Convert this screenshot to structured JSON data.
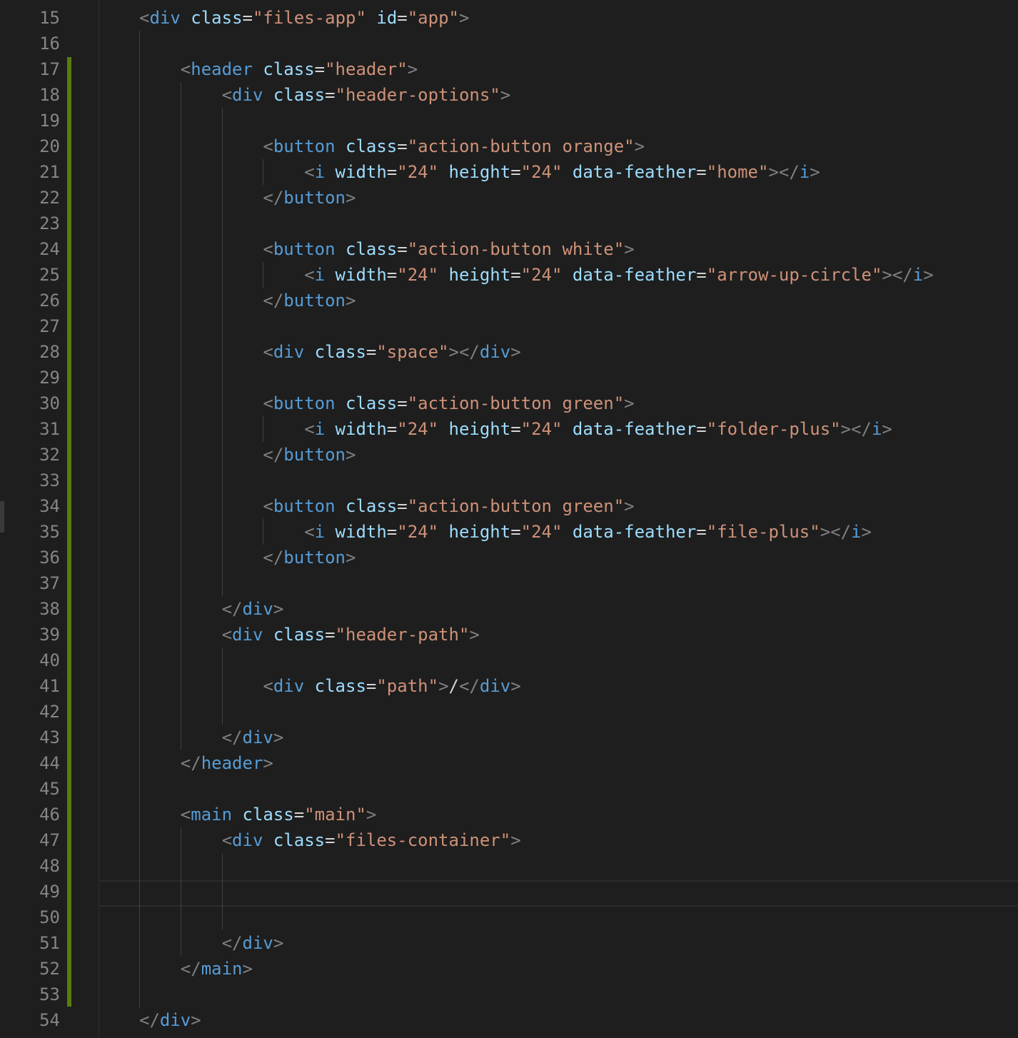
{
  "editor": {
    "lines": [
      {
        "number": "15",
        "indent": 1,
        "tokens": [
          {
            "t": "punct",
            "v": "<"
          },
          {
            "t": "tag",
            "v": "div"
          },
          {
            "t": "text",
            "v": " "
          },
          {
            "t": "attr",
            "v": "class"
          },
          {
            "t": "eq",
            "v": "="
          },
          {
            "t": "str",
            "v": "\"files-app\""
          },
          {
            "t": "text",
            "v": " "
          },
          {
            "t": "attr",
            "v": "id"
          },
          {
            "t": "eq",
            "v": "="
          },
          {
            "t": "str",
            "v": "\"app\""
          },
          {
            "t": "punct",
            "v": ">"
          }
        ]
      },
      {
        "number": "16",
        "indent": 0,
        "tokens": []
      },
      {
        "number": "17",
        "indent": 2,
        "tokens": [
          {
            "t": "punct",
            "v": "<"
          },
          {
            "t": "tag",
            "v": "header"
          },
          {
            "t": "text",
            "v": " "
          },
          {
            "t": "attr",
            "v": "class"
          },
          {
            "t": "eq",
            "v": "="
          },
          {
            "t": "str",
            "v": "\"header\""
          },
          {
            "t": "punct",
            "v": ">"
          }
        ]
      },
      {
        "number": "18",
        "indent": 3,
        "tokens": [
          {
            "t": "punct",
            "v": "<"
          },
          {
            "t": "tag",
            "v": "div"
          },
          {
            "t": "text",
            "v": " "
          },
          {
            "t": "attr",
            "v": "class"
          },
          {
            "t": "eq",
            "v": "="
          },
          {
            "t": "str",
            "v": "\"header-options\""
          },
          {
            "t": "punct",
            "v": ">"
          }
        ]
      },
      {
        "number": "19",
        "indent": 0,
        "tokens": []
      },
      {
        "number": "20",
        "indent": 4,
        "tokens": [
          {
            "t": "punct",
            "v": "<"
          },
          {
            "t": "tag",
            "v": "button"
          },
          {
            "t": "text",
            "v": " "
          },
          {
            "t": "attr",
            "v": "class"
          },
          {
            "t": "eq",
            "v": "="
          },
          {
            "t": "str",
            "v": "\"action-button orange\""
          },
          {
            "t": "punct",
            "v": ">"
          }
        ]
      },
      {
        "number": "21",
        "indent": 5,
        "tokens": [
          {
            "t": "punct",
            "v": "<"
          },
          {
            "t": "tag",
            "v": "i"
          },
          {
            "t": "text",
            "v": " "
          },
          {
            "t": "attr",
            "v": "width"
          },
          {
            "t": "eq",
            "v": "="
          },
          {
            "t": "str",
            "v": "\"24\""
          },
          {
            "t": "text",
            "v": " "
          },
          {
            "t": "attr",
            "v": "height"
          },
          {
            "t": "eq",
            "v": "="
          },
          {
            "t": "str",
            "v": "\"24\""
          },
          {
            "t": "text",
            "v": " "
          },
          {
            "t": "attr",
            "v": "data-feather"
          },
          {
            "t": "eq",
            "v": "="
          },
          {
            "t": "str",
            "v": "\"home\""
          },
          {
            "t": "punct",
            "v": "></"
          },
          {
            "t": "tag",
            "v": "i"
          },
          {
            "t": "punct",
            "v": ">"
          }
        ]
      },
      {
        "number": "22",
        "indent": 4,
        "tokens": [
          {
            "t": "punct",
            "v": "</"
          },
          {
            "t": "tag",
            "v": "button"
          },
          {
            "t": "punct",
            "v": ">"
          }
        ]
      },
      {
        "number": "23",
        "indent": 0,
        "tokens": []
      },
      {
        "number": "24",
        "indent": 4,
        "tokens": [
          {
            "t": "punct",
            "v": "<"
          },
          {
            "t": "tag",
            "v": "button"
          },
          {
            "t": "text",
            "v": " "
          },
          {
            "t": "attr",
            "v": "class"
          },
          {
            "t": "eq",
            "v": "="
          },
          {
            "t": "str",
            "v": "\"action-button white\""
          },
          {
            "t": "punct",
            "v": ">"
          }
        ]
      },
      {
        "number": "25",
        "indent": 5,
        "tokens": [
          {
            "t": "punct",
            "v": "<"
          },
          {
            "t": "tag",
            "v": "i"
          },
          {
            "t": "text",
            "v": " "
          },
          {
            "t": "attr",
            "v": "width"
          },
          {
            "t": "eq",
            "v": "="
          },
          {
            "t": "str",
            "v": "\"24\""
          },
          {
            "t": "text",
            "v": " "
          },
          {
            "t": "attr",
            "v": "height"
          },
          {
            "t": "eq",
            "v": "="
          },
          {
            "t": "str",
            "v": "\"24\""
          },
          {
            "t": "text",
            "v": " "
          },
          {
            "t": "attr",
            "v": "data-feather"
          },
          {
            "t": "eq",
            "v": "="
          },
          {
            "t": "str",
            "v": "\"arrow-up-circle\""
          },
          {
            "t": "punct",
            "v": "></"
          },
          {
            "t": "tag",
            "v": "i"
          },
          {
            "t": "punct",
            "v": ">"
          }
        ]
      },
      {
        "number": "26",
        "indent": 4,
        "tokens": [
          {
            "t": "punct",
            "v": "</"
          },
          {
            "t": "tag",
            "v": "button"
          },
          {
            "t": "punct",
            "v": ">"
          }
        ]
      },
      {
        "number": "27",
        "indent": 0,
        "tokens": []
      },
      {
        "number": "28",
        "indent": 4,
        "tokens": [
          {
            "t": "punct",
            "v": "<"
          },
          {
            "t": "tag",
            "v": "div"
          },
          {
            "t": "text",
            "v": " "
          },
          {
            "t": "attr",
            "v": "class"
          },
          {
            "t": "eq",
            "v": "="
          },
          {
            "t": "str",
            "v": "\"space\""
          },
          {
            "t": "punct",
            "v": "></"
          },
          {
            "t": "tag",
            "v": "div"
          },
          {
            "t": "punct",
            "v": ">"
          }
        ]
      },
      {
        "number": "29",
        "indent": 0,
        "tokens": []
      },
      {
        "number": "30",
        "indent": 4,
        "tokens": [
          {
            "t": "punct",
            "v": "<"
          },
          {
            "t": "tag",
            "v": "button"
          },
          {
            "t": "text",
            "v": " "
          },
          {
            "t": "attr",
            "v": "class"
          },
          {
            "t": "eq",
            "v": "="
          },
          {
            "t": "str",
            "v": "\"action-button green\""
          },
          {
            "t": "punct",
            "v": ">"
          }
        ]
      },
      {
        "number": "31",
        "indent": 5,
        "tokens": [
          {
            "t": "punct",
            "v": "<"
          },
          {
            "t": "tag",
            "v": "i"
          },
          {
            "t": "text",
            "v": " "
          },
          {
            "t": "attr",
            "v": "width"
          },
          {
            "t": "eq",
            "v": "="
          },
          {
            "t": "str",
            "v": "\"24\""
          },
          {
            "t": "text",
            "v": " "
          },
          {
            "t": "attr",
            "v": "height"
          },
          {
            "t": "eq",
            "v": "="
          },
          {
            "t": "str",
            "v": "\"24\""
          },
          {
            "t": "text",
            "v": " "
          },
          {
            "t": "attr",
            "v": "data-feather"
          },
          {
            "t": "eq",
            "v": "="
          },
          {
            "t": "str",
            "v": "\"folder-plus\""
          },
          {
            "t": "punct",
            "v": "></"
          },
          {
            "t": "tag",
            "v": "i"
          },
          {
            "t": "punct",
            "v": ">"
          }
        ]
      },
      {
        "number": "32",
        "indent": 4,
        "tokens": [
          {
            "t": "punct",
            "v": "</"
          },
          {
            "t": "tag",
            "v": "button"
          },
          {
            "t": "punct",
            "v": ">"
          }
        ]
      },
      {
        "number": "33",
        "indent": 0,
        "tokens": []
      },
      {
        "number": "34",
        "indent": 4,
        "tokens": [
          {
            "t": "punct",
            "v": "<"
          },
          {
            "t": "tag",
            "v": "button"
          },
          {
            "t": "text",
            "v": " "
          },
          {
            "t": "attr",
            "v": "class"
          },
          {
            "t": "eq",
            "v": "="
          },
          {
            "t": "str",
            "v": "\"action-button green\""
          },
          {
            "t": "punct",
            "v": ">"
          }
        ]
      },
      {
        "number": "35",
        "indent": 5,
        "tokens": [
          {
            "t": "punct",
            "v": "<"
          },
          {
            "t": "tag",
            "v": "i"
          },
          {
            "t": "text",
            "v": " "
          },
          {
            "t": "attr",
            "v": "width"
          },
          {
            "t": "eq",
            "v": "="
          },
          {
            "t": "str",
            "v": "\"24\""
          },
          {
            "t": "text",
            "v": " "
          },
          {
            "t": "attr",
            "v": "height"
          },
          {
            "t": "eq",
            "v": "="
          },
          {
            "t": "str",
            "v": "\"24\""
          },
          {
            "t": "text",
            "v": " "
          },
          {
            "t": "attr",
            "v": "data-feather"
          },
          {
            "t": "eq",
            "v": "="
          },
          {
            "t": "str",
            "v": "\"file-plus\""
          },
          {
            "t": "punct",
            "v": "></"
          },
          {
            "t": "tag",
            "v": "i"
          },
          {
            "t": "punct",
            "v": ">"
          }
        ]
      },
      {
        "number": "36",
        "indent": 4,
        "tokens": [
          {
            "t": "punct",
            "v": "</"
          },
          {
            "t": "tag",
            "v": "button"
          },
          {
            "t": "punct",
            "v": ">"
          }
        ]
      },
      {
        "number": "37",
        "indent": 0,
        "tokens": []
      },
      {
        "number": "38",
        "indent": 3,
        "tokens": [
          {
            "t": "punct",
            "v": "</"
          },
          {
            "t": "tag",
            "v": "div"
          },
          {
            "t": "punct",
            "v": ">"
          }
        ]
      },
      {
        "number": "39",
        "indent": 3,
        "tokens": [
          {
            "t": "punct",
            "v": "<"
          },
          {
            "t": "tag",
            "v": "div"
          },
          {
            "t": "text",
            "v": " "
          },
          {
            "t": "attr",
            "v": "class"
          },
          {
            "t": "eq",
            "v": "="
          },
          {
            "t": "str",
            "v": "\"header-path\""
          },
          {
            "t": "punct",
            "v": ">"
          }
        ]
      },
      {
        "number": "40",
        "indent": 0,
        "tokens": []
      },
      {
        "number": "41",
        "indent": 4,
        "tokens": [
          {
            "t": "punct",
            "v": "<"
          },
          {
            "t": "tag",
            "v": "div"
          },
          {
            "t": "text",
            "v": " "
          },
          {
            "t": "attr",
            "v": "class"
          },
          {
            "t": "eq",
            "v": "="
          },
          {
            "t": "str",
            "v": "\"path\""
          },
          {
            "t": "punct",
            "v": ">"
          },
          {
            "t": "text",
            "v": "/"
          },
          {
            "t": "punct",
            "v": "</"
          },
          {
            "t": "tag",
            "v": "div"
          },
          {
            "t": "punct",
            "v": ">"
          }
        ]
      },
      {
        "number": "42",
        "indent": 0,
        "tokens": []
      },
      {
        "number": "43",
        "indent": 3,
        "tokens": [
          {
            "t": "punct",
            "v": "</"
          },
          {
            "t": "tag",
            "v": "div"
          },
          {
            "t": "punct",
            "v": ">"
          }
        ]
      },
      {
        "number": "44",
        "indent": 2,
        "tokens": [
          {
            "t": "punct",
            "v": "</"
          },
          {
            "t": "tag",
            "v": "header"
          },
          {
            "t": "punct",
            "v": ">"
          }
        ]
      },
      {
        "number": "45",
        "indent": 0,
        "tokens": []
      },
      {
        "number": "46",
        "indent": 2,
        "tokens": [
          {
            "t": "punct",
            "v": "<"
          },
          {
            "t": "tag",
            "v": "main"
          },
          {
            "t": "text",
            "v": " "
          },
          {
            "t": "attr",
            "v": "class"
          },
          {
            "t": "eq",
            "v": "="
          },
          {
            "t": "str",
            "v": "\"main\""
          },
          {
            "t": "punct",
            "v": ">"
          }
        ]
      },
      {
        "number": "47",
        "indent": 3,
        "tokens": [
          {
            "t": "punct",
            "v": "<"
          },
          {
            "t": "tag",
            "v": "div"
          },
          {
            "t": "text",
            "v": " "
          },
          {
            "t": "attr",
            "v": "class"
          },
          {
            "t": "eq",
            "v": "="
          },
          {
            "t": "str",
            "v": "\"files-container\""
          },
          {
            "t": "punct",
            "v": ">"
          }
        ]
      },
      {
        "number": "48",
        "indent": 0,
        "tokens": []
      },
      {
        "number": "49",
        "indent": 0,
        "tokens": []
      },
      {
        "number": "50",
        "indent": 0,
        "tokens": []
      },
      {
        "number": "51",
        "indent": 3,
        "tokens": [
          {
            "t": "punct",
            "v": "</"
          },
          {
            "t": "tag",
            "v": "div"
          },
          {
            "t": "punct",
            "v": ">"
          }
        ]
      },
      {
        "number": "52",
        "indent": 2,
        "tokens": [
          {
            "t": "punct",
            "v": "</"
          },
          {
            "t": "tag",
            "v": "main"
          },
          {
            "t": "punct",
            "v": ">"
          }
        ]
      },
      {
        "number": "53",
        "indent": 0,
        "tokens": []
      },
      {
        "number": "54",
        "indent": 1,
        "tokens": [
          {
            "t": "punct",
            "v": "</"
          },
          {
            "t": "tag",
            "v": "div"
          },
          {
            "t": "punct",
            "v": ">"
          }
        ]
      }
    ]
  },
  "colors": {
    "background": "#1e1e1e",
    "line_number": "#858585",
    "punctuation": "#808080",
    "tag": "#569cd6",
    "attribute": "#9cdcfe",
    "string": "#ce9178",
    "text": "#d4d4d4",
    "git_modified_bar": "#587c0c"
  }
}
